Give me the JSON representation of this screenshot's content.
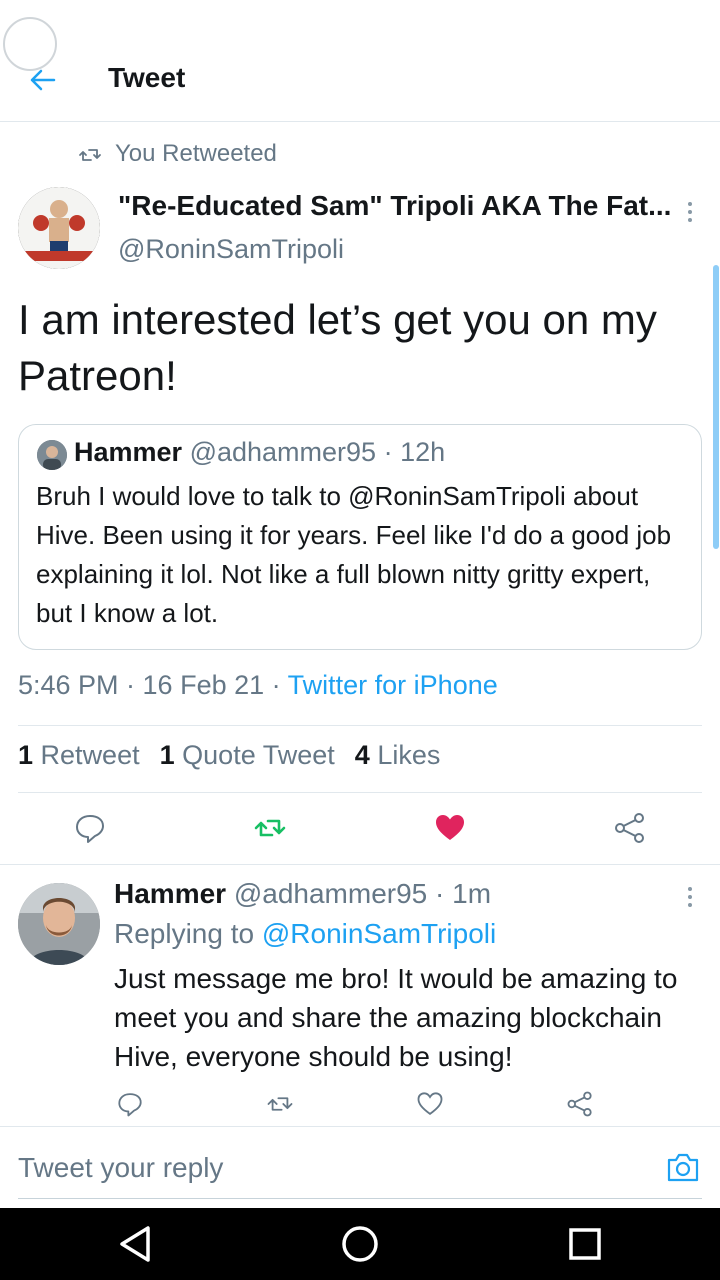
{
  "header": {
    "title": "Tweet"
  },
  "retweet_context": {
    "text": "You Retweeted"
  },
  "tweet": {
    "author_name": "\"Re-Educated Sam\" Tripoli AKA The Fat...",
    "author_handle": "@RoninSamTripoli",
    "text": "I am interested let’s get you on my Patreon!",
    "timestamp": "5:46 PM · 16 Feb 21 · ",
    "source": "Twitter for iPhone",
    "stats": {
      "retweets_count": "1",
      "retweets_label": "Retweet",
      "quotes_count": "1",
      "quotes_label": "Quote Tweet",
      "likes_count": "4",
      "likes_label": "Likes"
    },
    "liked": true,
    "retweeted": true
  },
  "quoted_tweet": {
    "author_name": "Hammer",
    "author_handle": "@adhammer95",
    "time": "· 12h",
    "text": "Bruh I would love to talk to @RoninSamTripoli about Hive. Been using it for years. Feel like I'd do a good job explaining it lol. Not like a full blown nitty gritty expert, but I know a lot."
  },
  "reply": {
    "author_name": "Hammer",
    "author_handle": "@adhammer95",
    "time": "· 1m",
    "replying_prefix": "Replying to ",
    "replying_to": "@RoninSamTripoli",
    "text": "Just message me bro! It would be amazing to meet you and share the amazing blockchain Hive, everyone should be using!"
  },
  "compose": {
    "placeholder": "Tweet your reply"
  },
  "colors": {
    "accent": "#1da1f2",
    "retweet": "#17bf63",
    "like": "#e0245e",
    "muted": "#657786"
  },
  "icons": [
    "back-arrow-icon",
    "retweet-icon",
    "more-icon",
    "reply-icon",
    "like-icon",
    "share-icon",
    "camera-icon",
    "nav-back-icon",
    "nav-home-icon",
    "nav-recents-icon"
  ]
}
